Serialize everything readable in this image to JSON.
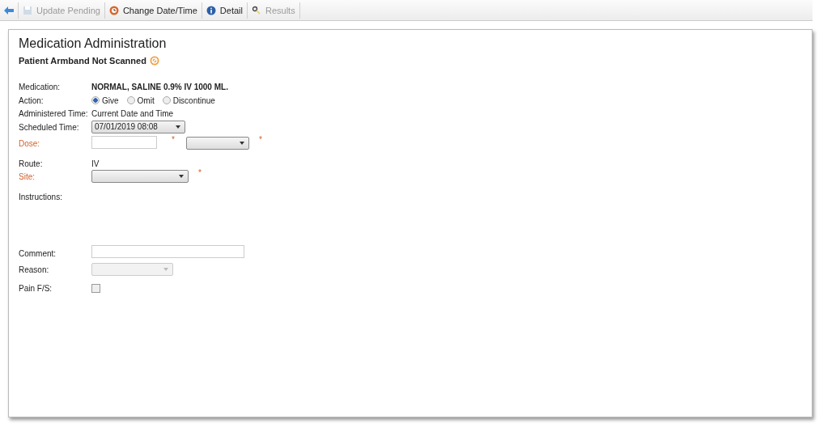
{
  "toolbar": [
    {
      "kind": "back",
      "disabled": false
    },
    {
      "kind": "save",
      "label": "Update Pending",
      "disabled": true
    },
    {
      "kind": "clock",
      "label": "Change Date/Time",
      "disabled": false
    },
    {
      "kind": "info",
      "label": "Detail",
      "disabled": false
    },
    {
      "kind": "results",
      "label": "Results",
      "disabled": true
    }
  ],
  "title": "Medication Administration",
  "armband": {
    "text": "Patient Armband Not Scanned",
    "warning": true
  },
  "fields": [
    {
      "kind": "text",
      "label": "Medication:",
      "required": false,
      "value": "NORMAL, SALINE 0.9% IV 1000 ML."
    },
    {
      "kind": "radio",
      "label": "Action:",
      "required": false,
      "options": [
        {
          "label": "Give",
          "selected": true
        },
        {
          "label": "Omit",
          "selected": false
        },
        {
          "label": "Discontinue",
          "selected": false
        }
      ]
    },
    {
      "kind": "text",
      "label": "Administered Time:",
      "required": false,
      "value": "Current Date and Time"
    },
    {
      "kind": "select",
      "label": "Scheduled Time:",
      "required": false,
      "value": "07/01/2019 08:08",
      "disabled": false
    },
    {
      "kind": "dose",
      "label": "Dose:",
      "required": true,
      "required_marks": [
        "*",
        "*"
      ]
    },
    {
      "kind": "text",
      "label": "Route:",
      "required": false,
      "value": "IV"
    },
    {
      "kind": "select",
      "label": "Site:",
      "required": true,
      "disabled": false,
      "required_marks": [
        "*"
      ]
    },
    {
      "kind": "block",
      "label": "Instructions:",
      "required": false
    },
    {
      "kind": "input",
      "label": "Comment:",
      "required": false
    },
    {
      "kind": "select",
      "label": "Reason:",
      "required": false,
      "disabled": true
    },
    {
      "kind": "checkbox",
      "label": "Pain F/S:",
      "required": false,
      "checked": false
    }
  ]
}
